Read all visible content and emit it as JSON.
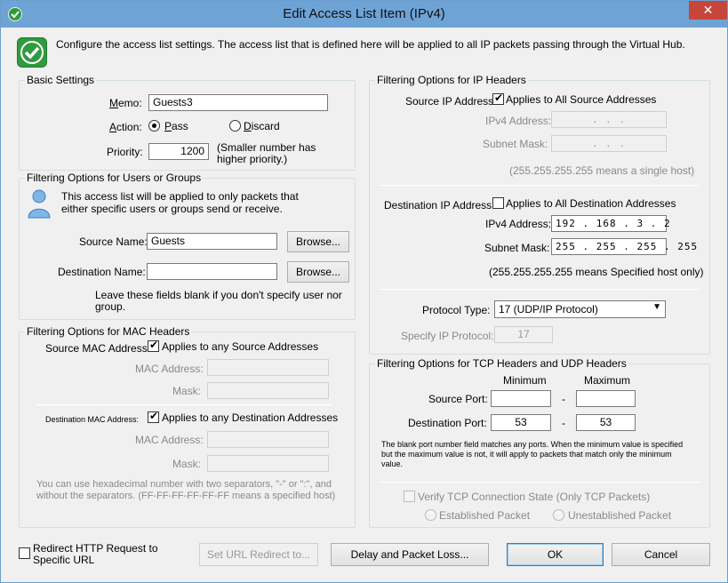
{
  "window": {
    "title": "Edit Access List Item (IPv4)",
    "close_label": "✕"
  },
  "intro": "Configure the access list settings. The access list that is defined here will be applied to all IP packets passing through the Virtual Hub.",
  "basic": {
    "title": "Basic Settings",
    "memo_label": "Memo:",
    "memo_value": "Guests3",
    "action_label": "Action:",
    "pass_label": "Pass",
    "discard_label": "Discard",
    "priority_label": "Priority:",
    "priority_value": "1200",
    "priority_note": "(Smaller number has higher priority.)",
    "action_selected": "Pass"
  },
  "users": {
    "title": "Filtering Options for Users or Groups",
    "desc": "This access list will be applied to only packets that either specific users or groups send or receive.",
    "source_label": "Source Name:",
    "source_value": "Guests",
    "dest_label": "Destination Name:",
    "dest_value": "",
    "browse1": "Browse...",
    "browse2": "Browse...",
    "note": "Leave these fields blank if you don't specify user nor group."
  },
  "mac": {
    "title": "Filtering Options for MAC Headers",
    "src_label": "Source MAC Address:",
    "src_any": "Applies to any Source Addresses",
    "src_any_checked": true,
    "mac_label1": "MAC Address:",
    "mask_label1": "Mask:",
    "dst_label": "Destination MAC Address:",
    "dst_any": "Applies to any Destination Addresses",
    "dst_any_checked": true,
    "mac_label2": "MAC Address:",
    "mask_label2": "Mask:",
    "note": "You can use hexadecimal number with two separators, \"-\" or \":\", and without the separators. (FF-FF-FF-FF-FF-FF means a specified host)"
  },
  "ip": {
    "title": "Filtering Options for IP Headers",
    "src_label": "Source IP Address:",
    "src_all": "Applies to All Source Addresses",
    "src_all_checked": true,
    "src_ipv4_label": "IPv4 Address:",
    "src_ipv4_value": ".      .      .",
    "src_mask_label": "Subnet Mask:",
    "src_mask_value": ".      .      .",
    "src_note": "(255.255.255.255 means a single host)",
    "dst_label": "Destination IP Address:",
    "dst_all": "Applies to All Destination Addresses",
    "dst_all_checked": false,
    "dst_ipv4_label": "IPv4 Address:",
    "dst_ipv4_value": "192 . 168 .  3  .  2",
    "dst_mask_label": "Subnet Mask:",
    "dst_mask_value": "255 . 255 . 255 . 255",
    "dst_note": "(255.255.255.255 means Specified host only)",
    "proto_label": "Protocol Type:",
    "proto_value": "17 (UDP/IP Protocol)",
    "spec_label": "Specify IP Protocol:",
    "spec_value": "17"
  },
  "tcp": {
    "title": "Filtering Options for  TCP Headers and UDP Headers",
    "min_label": "Minimum",
    "max_label": "Maximum",
    "src_port_label": "Source Port:",
    "src_min": "",
    "src_max": "",
    "dst_port_label": "Destination Port:",
    "dst_min": "53",
    "dst_max": "53",
    "dash": "-",
    "note": "The blank port number field matches any ports. When the minimum value is specified but the maximum value is not, it will apply to packets that match only the minimum value.",
    "verify_label": "Verify TCP Connection State (Only TCP Packets)",
    "established": "Established Packet",
    "unestablished": "Unestablished Packet"
  },
  "footer": {
    "redirect_label": "Redirect HTTP Request to Specific URL",
    "set_url": "Set URL Redirect to...",
    "delay": "Delay and Packet Loss...",
    "ok": "OK",
    "cancel": "Cancel"
  },
  "colors": {
    "titlebar": "#6ea3d6",
    "close": "#c7463c",
    "accent_green": "#2f9b3f"
  }
}
